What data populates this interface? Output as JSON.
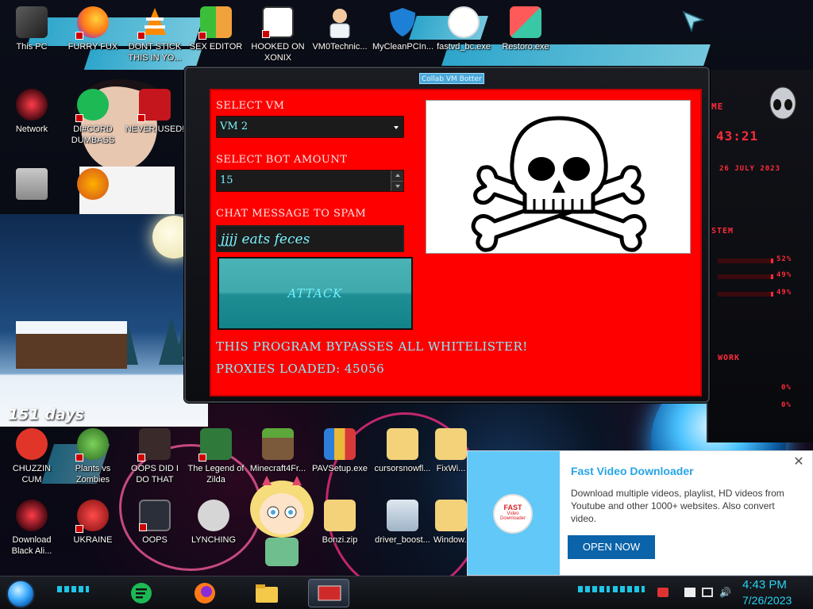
{
  "desktop_icons": {
    "row1": [
      {
        "label": "This PC",
        "icon": "this-pc-icon"
      },
      {
        "label": "FURRY FUX",
        "icon": "firefox-icon"
      },
      {
        "label": "DONT STICK THIS IN YO...",
        "icon": "vlc-cone-icon"
      },
      {
        "label": "SEX EDITOR",
        "icon": "hxd-editor-icon"
      },
      {
        "label": "HOOKED ON XONIX",
        "icon": "xonix-game-icon"
      },
      {
        "label": "VM0Technic...",
        "icon": "doctor-icon"
      },
      {
        "label": "MyCleanPCIn...",
        "icon": "shield-icon"
      },
      {
        "label": "fastvd_bc.exe",
        "icon": "fast-video-icon"
      },
      {
        "label": "Restoro.exe",
        "icon": "restoro-icon"
      }
    ],
    "row2": [
      {
        "label": "Network",
        "icon": "network-globe-icon"
      },
      {
        "label": "DI#CORD DUMBASS",
        "icon": "notes-icon"
      },
      {
        "label": "NEVER USED!",
        "icon": "dev-cpp-icon"
      }
    ],
    "bottom": [
      {
        "label": "CHUZZIN CUM",
        "icon": "chuzzle-icon"
      },
      {
        "label": "Plants vs Zombies",
        "icon": "plant-icon"
      },
      {
        "label": "OOPS DID I DO THAT",
        "icon": "portrait-icon"
      },
      {
        "label": "The Legend of Zilda",
        "icon": "zelda-sprite-icon"
      },
      {
        "label": "Minecraft4Fr...",
        "icon": "minecraft-block-icon"
      },
      {
        "label": "PAVSetup.exe",
        "icon": "installer-box-icon"
      },
      {
        "label": "cursorsnowfl...",
        "icon": "zip-folder-icon"
      },
      {
        "label": "FixWi...",
        "icon": "zip-folder-icon"
      },
      {
        "label": "Download Black Ali...",
        "icon": "alienware-icon"
      },
      {
        "label": "UKRAINE",
        "icon": "radiation-icon"
      },
      {
        "label": "OOPS",
        "icon": "laptop-icon"
      },
      {
        "label": "LYNCHING",
        "icon": "gear-badge-icon"
      },
      {
        "label": "Bonzi.zip",
        "icon": "zip-folder-icon"
      },
      {
        "label": "driver_boost...",
        "icon": "iobit-icon"
      },
      {
        "label": "Window...",
        "icon": "folder-icon"
      }
    ]
  },
  "hud": {
    "time": "43:21",
    "date": "26 JULY 2023",
    "system_label": "STEM",
    "network_label": "WORK",
    "cpu": "52%",
    "ram": "49%",
    "disk": "49%",
    "net1": "0%",
    "net2": "0%"
  },
  "widget": {
    "days": "151 days"
  },
  "app": {
    "title": "Collab VM Botter",
    "select_vm_label": "SELECT VM",
    "select_vm_value": "VM 2",
    "bot_amount_label": "SELECT BOT AMOUNT",
    "bot_amount_value": "15",
    "chat_label": "CHAT MESSAGE TO SPAM",
    "chat_value": "jjjj eats feces",
    "attack_label": "ATTACK",
    "bypass_text": "THIS PROGRAM BYPASSES ALL WHITELISTER!",
    "proxies_text": "PROXIES LOADED: 45056",
    "skull_icon": "skull-crossbones-icon"
  },
  "notification": {
    "title": "Fast Video Downloader",
    "body": "Download multiple videos, playlist, HD videos from Youtube and other 1000+ websites. Also convert video.",
    "button": "OPEN NOW",
    "logo_top": "FAST",
    "logo_bottom": "Video Downloader"
  },
  "taskbar": {
    "time": "4:43 PM",
    "date": "7/26/2023"
  },
  "colors": {
    "window_body": "#ff0000",
    "accent_cyan": "#7ff3ff",
    "clock": "#27d3f2",
    "notif_title": "#27a4e6"
  }
}
